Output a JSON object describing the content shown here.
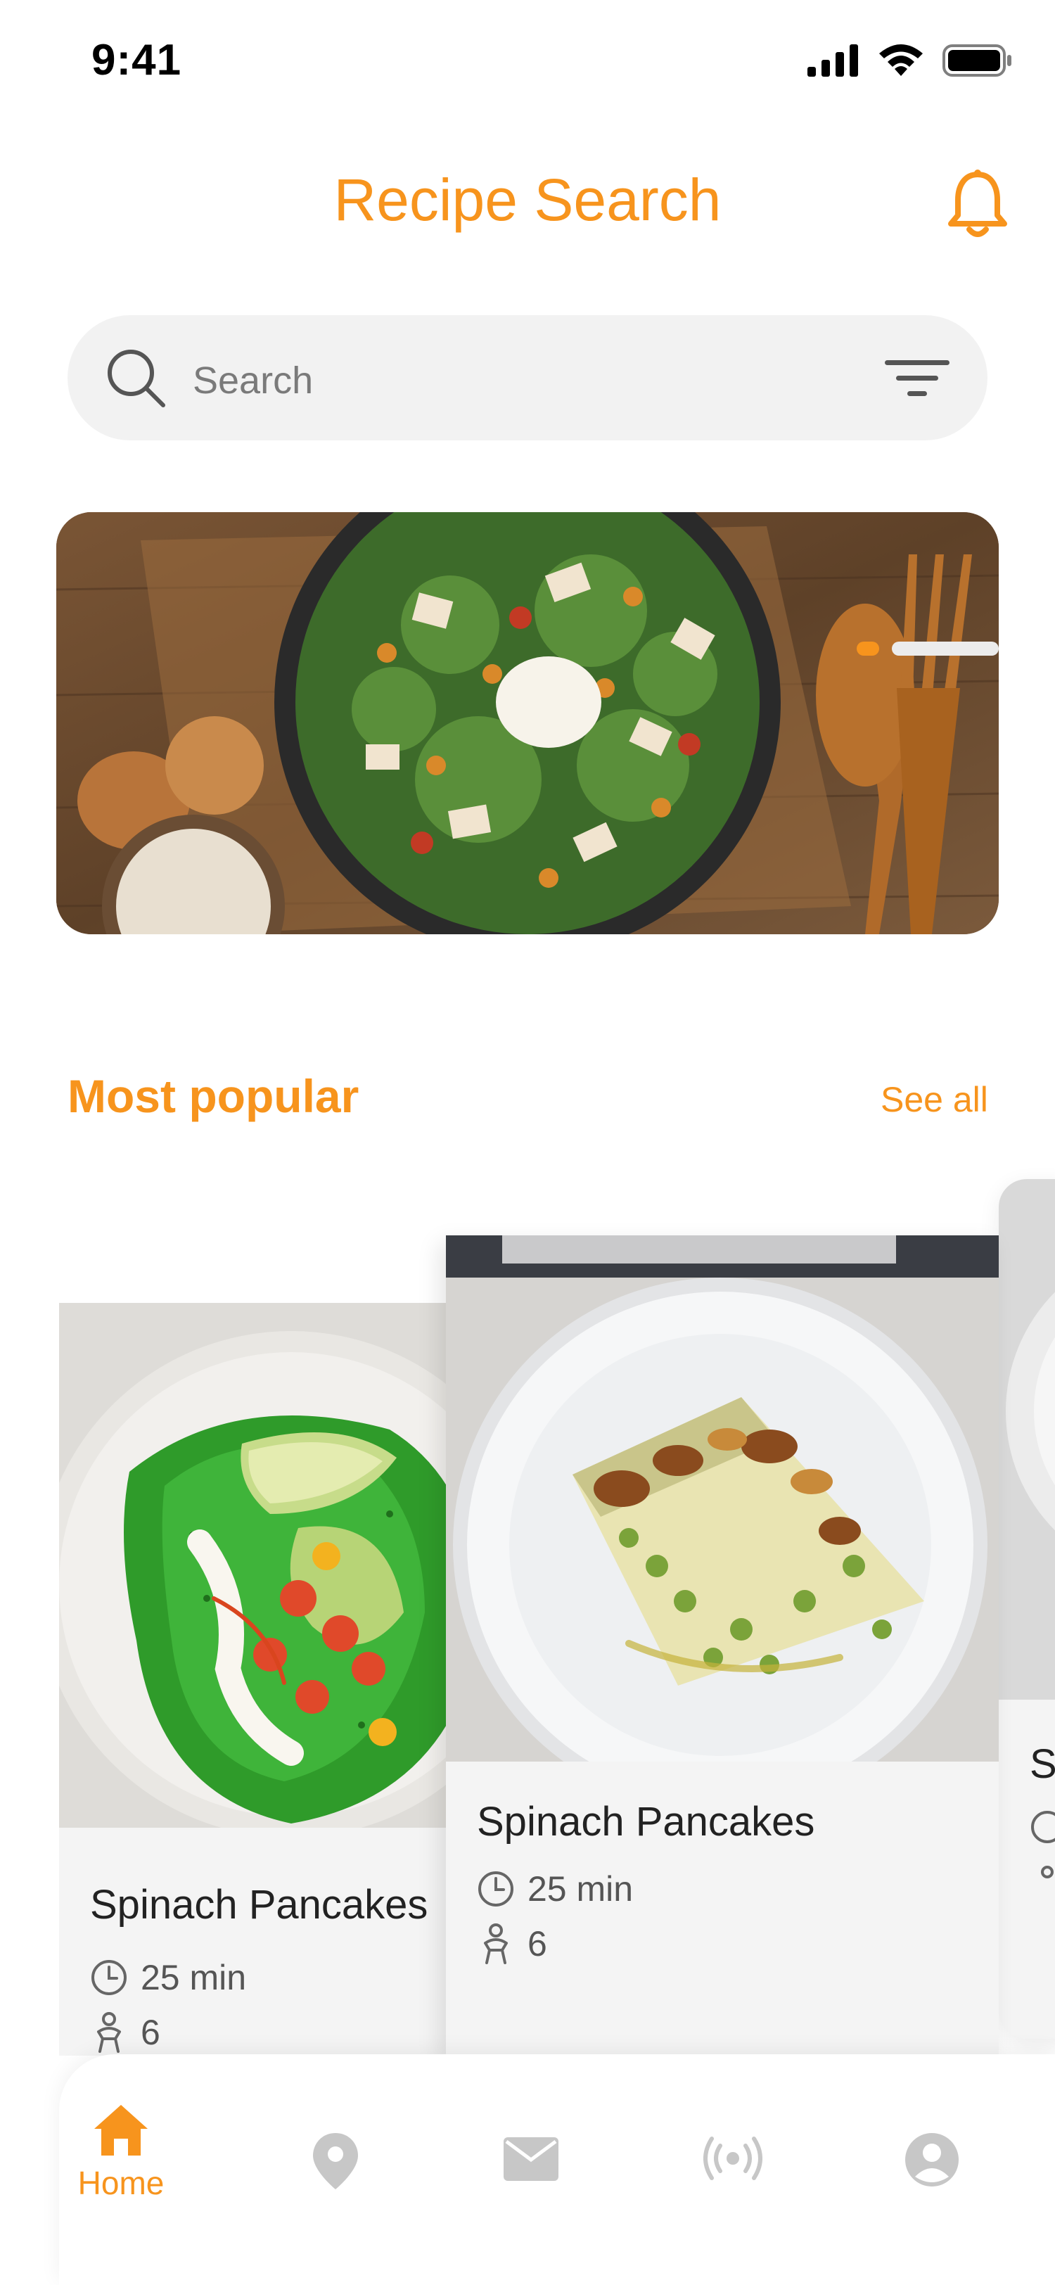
{
  "status_bar": {
    "time": "9:41"
  },
  "header": {
    "title": "Recipe Search"
  },
  "search": {
    "placeholder": "Search"
  },
  "hero": {
    "slide_count": 2,
    "active_slide": 1
  },
  "popular": {
    "title": "Most popular",
    "see_all": "See all",
    "cards": [
      {
        "title": "Spinach Pancakes",
        "time": "25 min",
        "servings": "6"
      },
      {
        "title": "Spinach Pancakes",
        "time": "25 min",
        "servings": "6"
      }
    ]
  },
  "nav": {
    "items": [
      {
        "label": "Home",
        "icon": "home-icon",
        "active": true
      },
      {
        "label": "",
        "icon": "location-icon"
      },
      {
        "label": "",
        "icon": "mail-icon"
      },
      {
        "label": "",
        "icon": "broadcast-icon"
      },
      {
        "label": "",
        "icon": "profile-icon"
      }
    ]
  },
  "colors": {
    "accent": "#f7941d",
    "nav_inactive": "#c7c7c7",
    "card_bg": "#f4f4f4"
  }
}
